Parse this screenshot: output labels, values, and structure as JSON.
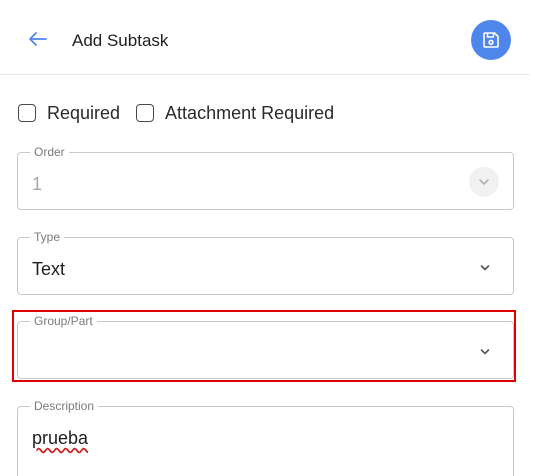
{
  "header": {
    "title": "Add Subtask",
    "back_icon": "arrow-left-icon",
    "save_icon": "save-floppy-icon",
    "accent": "#4f86ec"
  },
  "options": {
    "required_label": "Required",
    "attachment_required_label": "Attachment Required"
  },
  "fields": {
    "order": {
      "label": "Order",
      "value": "1"
    },
    "type": {
      "label": "Type",
      "value": "Text"
    },
    "group": {
      "label": "Group/Part",
      "value": ""
    },
    "description": {
      "label": "Description",
      "value": "prueba"
    }
  },
  "highlight_color": "#e00000"
}
